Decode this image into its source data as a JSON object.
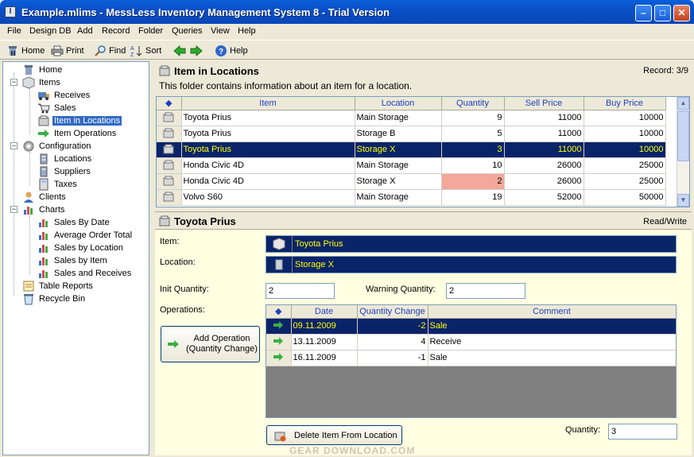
{
  "window": {
    "title": "Example.mlims - MessLess Inventory Management System 8 - Trial Version",
    "app_icon_glyph": "I"
  },
  "menu": [
    "File",
    "Design DB",
    "Add",
    "Record",
    "Folder",
    "Queries",
    "View",
    "Help"
  ],
  "toolbar": {
    "home": "Home",
    "print": "Print",
    "find": "Find",
    "sort": "Sort",
    "help": "Help"
  },
  "tree": {
    "home": "Home",
    "items": "Items",
    "receives": "Receives",
    "sales": "Sales",
    "item_in_locations": "Item in Locations",
    "item_operations": "Item Operations",
    "configuration": "Configuration",
    "locations": "Locations",
    "suppliers": "Suppliers",
    "taxes": "Taxes",
    "clients": "Clients",
    "charts": "Charts",
    "sales_by_date": "Sales By Date",
    "average_order_total": "Average Order Total",
    "sales_by_location": "Sales by Location",
    "sales_by_item": "Sales by Item",
    "sales_and_receives": "Sales and Receives",
    "table_reports": "Table Reports",
    "recycle_bin": "Recycle Bin"
  },
  "main": {
    "title": "Item in Locations",
    "record": "Record: 3/9",
    "description": "This folder contains information about an item for a location.",
    "columns": [
      "Item",
      "Location",
      "Quantity",
      "Sell Price",
      "Buy Price"
    ],
    "rows": [
      {
        "item": "Toyota Prius",
        "location": "Main Storage",
        "quantity": "9",
        "sell": "11000",
        "buy": "10000"
      },
      {
        "item": "Toyota Prius",
        "location": "Storage B",
        "quantity": "5",
        "sell": "11000",
        "buy": "10000"
      },
      {
        "item": "Toyota Prius",
        "location": "Storage X",
        "quantity": "3",
        "sell": "11000",
        "buy": "10000"
      },
      {
        "item": "Honda Civic 4D",
        "location": "Main Storage",
        "quantity": "10",
        "sell": "26000",
        "buy": "25000"
      },
      {
        "item": "Honda Civic 4D",
        "location": "Storage X",
        "quantity": "2",
        "sell": "26000",
        "buy": "25000"
      },
      {
        "item": "Volvo S60",
        "location": "Main Storage",
        "quantity": "19",
        "sell": "52000",
        "buy": "50000"
      }
    ],
    "selected_row": 2,
    "warning_row": 4
  },
  "detail": {
    "title": "Toyota Prius",
    "mode": "Read/Write",
    "item_label": "Item:",
    "item_value": "Toyota Prius",
    "location_label": "Location:",
    "location_value": "Storage X",
    "init_qty_label": "Init Quantity:",
    "init_qty_value": "2",
    "warning_qty_label": "Warning Quantity:",
    "warning_qty_value": "2",
    "operations_label": "Operations:",
    "add_operation_button": "Add Operation\n(Quantity Change)",
    "op_columns": [
      "Date",
      "Quantity Change",
      "Comment"
    ],
    "operations": [
      {
        "date": "09.11.2009",
        "change": "-2",
        "comment": "Sale"
      },
      {
        "date": "13.11.2009",
        "change": "4",
        "comment": "Receive"
      },
      {
        "date": "16.11.2009",
        "change": "-1",
        "comment": "Sale"
      }
    ],
    "delete_button": "Delete Item From Location",
    "quantity_label": "Quantity:",
    "quantity_value": "3"
  },
  "watermark": "GEAR DOWNLOAD.COM",
  "colors": {
    "selection_bg": "#0a246a",
    "selection_text": "#ffff00",
    "warning_cell": "#f4a79b",
    "detail_bg": "#ffffe1"
  }
}
